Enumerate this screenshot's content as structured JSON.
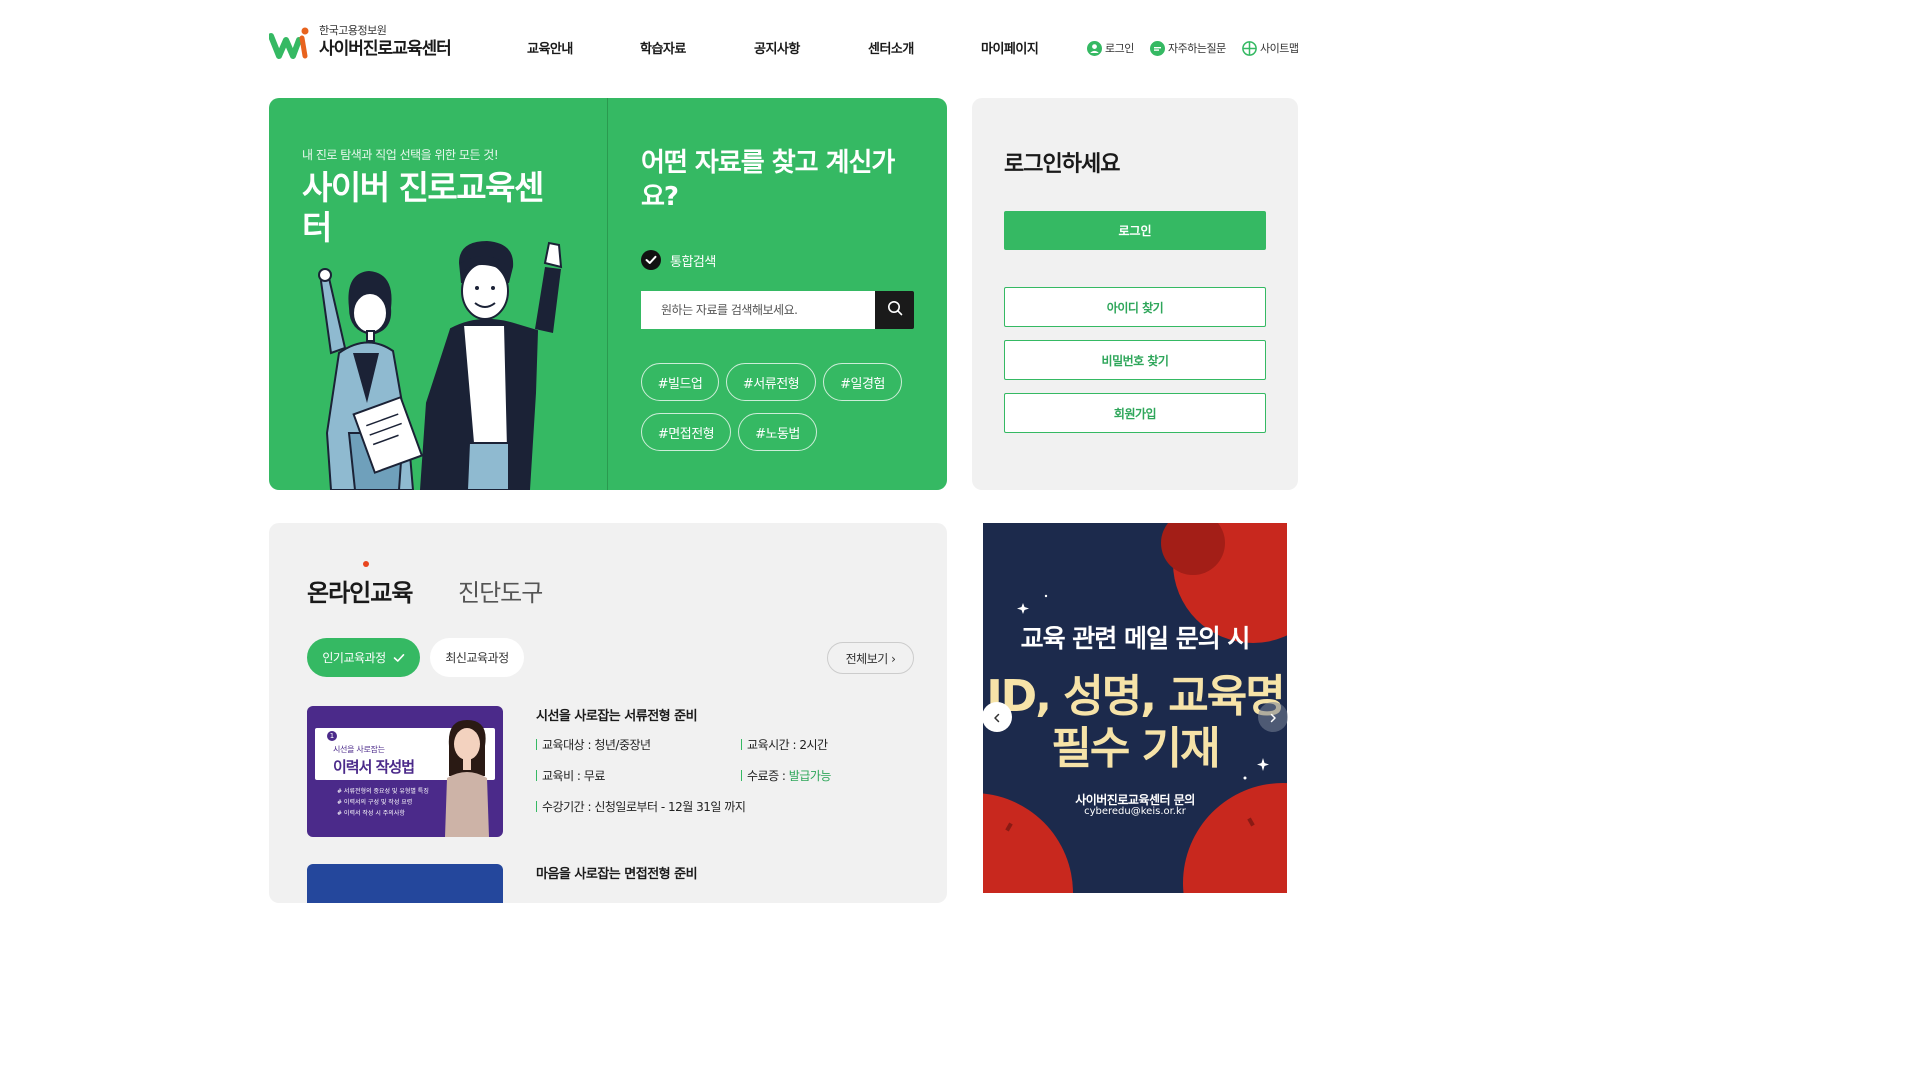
{
  "header": {
    "logo_sub": "한국고용정보원",
    "logo_title": "사이버진로교육센터",
    "nav": [
      "교육안내",
      "학습자료",
      "공지사항",
      "센터소개",
      "마이페이지"
    ],
    "util": {
      "login": "로그인",
      "faq": "자주하는질문",
      "sitemap": "사이트맵"
    }
  },
  "hero": {
    "eyebrow": "내 진로 탐색과 직업 선택을 위한 모든 것!",
    "title": "사이버 진로교육센터",
    "search_question": "어떤 자료를 찾고 계신가요?",
    "scope_label": "통합검색",
    "search_placeholder": "원하는 자료를 검색해보세요.",
    "tags": [
      "#빌드업",
      "#서류전형",
      "#일경험",
      "#면접전형",
      "#노동법"
    ]
  },
  "login_panel": {
    "title": "로그인하세요",
    "login_button": "로그인",
    "find_id": "아이디 찾기",
    "find_password": "비밀번호 찾기",
    "signup": "회원가입"
  },
  "education": {
    "tabs": [
      "온라인교육",
      "진단도구"
    ],
    "filters": [
      "인기교육과정",
      "최신교육과정"
    ],
    "view_all": "전체보기 ›",
    "courses": [
      {
        "title": "시선을 사로잡는 서류전형 준비",
        "target": "교육대상 : 청년/중장년",
        "time": "교육시간 : 2시간",
        "fee": "교육비 : 무료",
        "cert_label": "수료증 : ",
        "cert_value": "발급가능",
        "period": "수강기간 : 신청일로부터 - 12월 31일 까지",
        "thumb": {
          "badge": "1",
          "subtitle": "시선을 사로잡는",
          "title": "이력서 작성법",
          "bullets": [
            "# 서류전형의 중요성 및 유형별 특징",
            "# 이력서의 구성 및 작성 요령",
            "# 이력서 작성 시 주의사항"
          ]
        }
      },
      {
        "title": "마음을 사로잡는 면접전형 준비"
      }
    ]
  },
  "banner": {
    "line1": "교육 관련 메일 문의 시",
    "line2a": "ID, 성명, 교육명",
    "line2b": "필수 기재",
    "line3": "사이버진로교육센터 문의",
    "email": "cyberedu@keis.or.kr"
  },
  "colors": {
    "brand_green": "#35b963",
    "banner_navy": "#1c2a4c",
    "banner_red": "#c8281e",
    "panel_gray": "#f1f1f1"
  }
}
